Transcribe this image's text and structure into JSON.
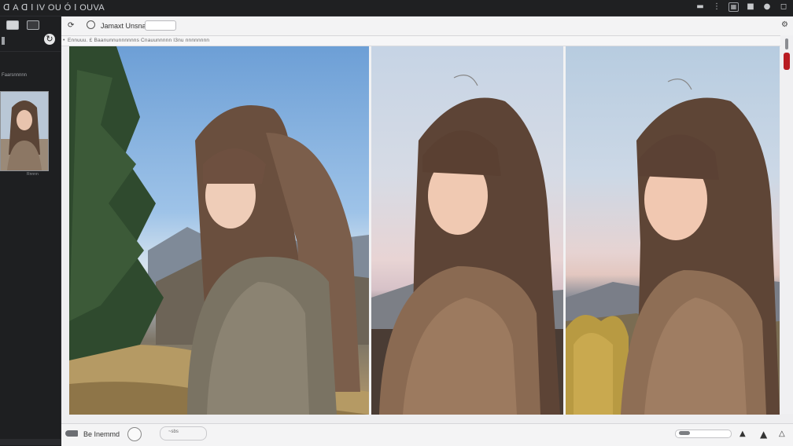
{
  "window": {
    "title": "ꓷ A ꓷ ꓲ IV OU Ó ꓲ OUVA",
    "icons": [
      "minimize-icon",
      "settings-icon",
      "copy-icon",
      "lock-icon",
      "share-icon",
      "close-icon"
    ]
  },
  "toolbar": {
    "label": "Jamaxt Unsnal"
  },
  "breadcrumb": {
    "text": "Ennuuu. £ Baanunnunnnnnns Cnauunnnnn I3nu nnnnnnnn"
  },
  "sidebar": {
    "caption": "Faarsnnnnn",
    "thumb_caption": "Rnnnn"
  },
  "statusbar": {
    "label": "Be Inemmd",
    "dash_text": "~sbs"
  },
  "colors": {
    "accent_red": "#b91c22",
    "sidebar_bg": "#1e1f21",
    "main_bg": "#eeeef0"
  }
}
